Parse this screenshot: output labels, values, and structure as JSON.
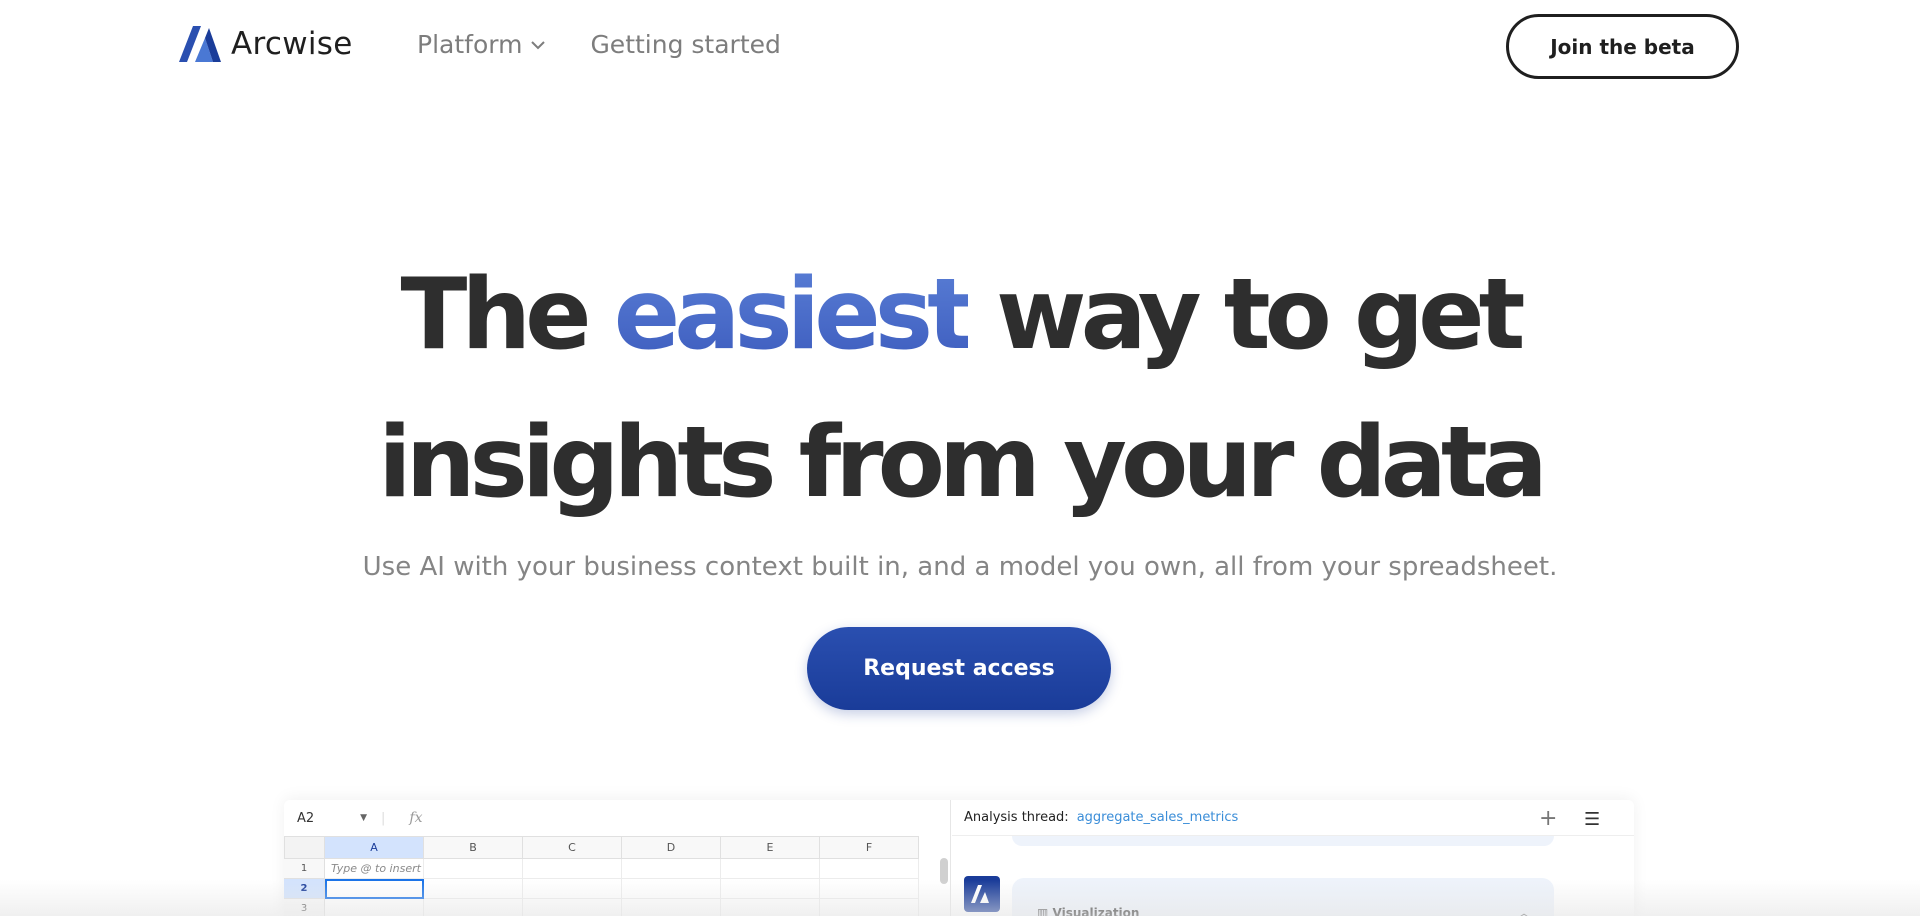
{
  "brand": {
    "name": "Arcwise",
    "color": "#2a4fb0"
  },
  "nav": {
    "items": [
      {
        "label": "Platform",
        "icon": "chevron-down-icon"
      },
      {
        "label": "Getting started"
      }
    ],
    "join_label": "Join the beta"
  },
  "hero": {
    "line1_before": "The",
    "line1_accent": "easiest",
    "line1_after": "way to get",
    "line2": "insights from your data",
    "subtitle": "Use AI with your business context built in, and a model you own, all from your spreadsheet.",
    "cta_label": "Request access",
    "accent_color": "#4567c9"
  },
  "preview": {
    "sheet": {
      "cell_ref": "A2",
      "fx_label": "fx",
      "columns": [
        "A",
        "B",
        "C",
        "D",
        "E",
        "F"
      ],
      "rows": [
        "1",
        "2",
        "3"
      ],
      "cell_a1_placeholder": "Type @ to insert"
    },
    "thread": {
      "label": "Analysis thread:",
      "name": "aggregate_sales_metrics",
      "visualization_label": "Visualization"
    }
  }
}
